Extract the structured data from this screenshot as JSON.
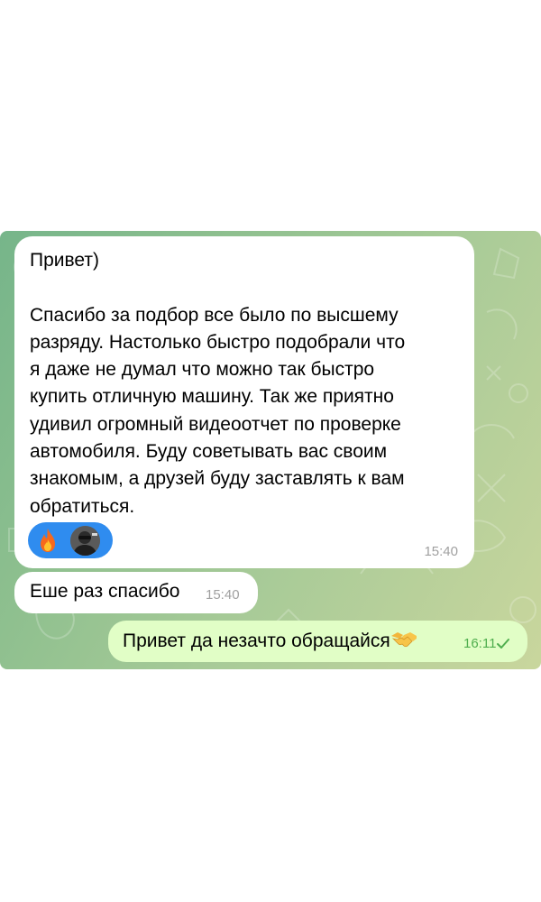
{
  "messages": [
    {
      "direction": "incoming",
      "lines": [
        "Привет)",
        "",
        "Спасибо за подбор все было по высшему",
        "разряду. Настолько быстро подобрали что",
        "я даже не думал что можно так быстро",
        "купить отличную машину. Так же приятно",
        "удивил огромный видеоотчет по проверке",
        "автомобиля. Буду советывать вас своим",
        "знакомым, а друзей буду заставлять к вам",
        "обратиться."
      ],
      "reactions": [
        {
          "emoji": "fire-emoji"
        },
        {
          "avatar": "user-avatar"
        }
      ],
      "time": "15:40"
    },
    {
      "direction": "incoming",
      "text": "Еше раз спасибо",
      "time": "15:40"
    },
    {
      "direction": "outgoing",
      "text": "Привет да незачто обращайся",
      "emoji": "handshake-emoji",
      "time": "16:11",
      "status": "sent-checkmark-icon"
    }
  ],
  "colors": {
    "incoming_bubble": "#ffffff",
    "outgoing_bubble": "#e1fec6",
    "reaction_pill": "#2f8cef",
    "outgoing_time": "#4fae4e",
    "incoming_time": "#a0a0a0",
    "wallpaper": "#8fc08f"
  }
}
